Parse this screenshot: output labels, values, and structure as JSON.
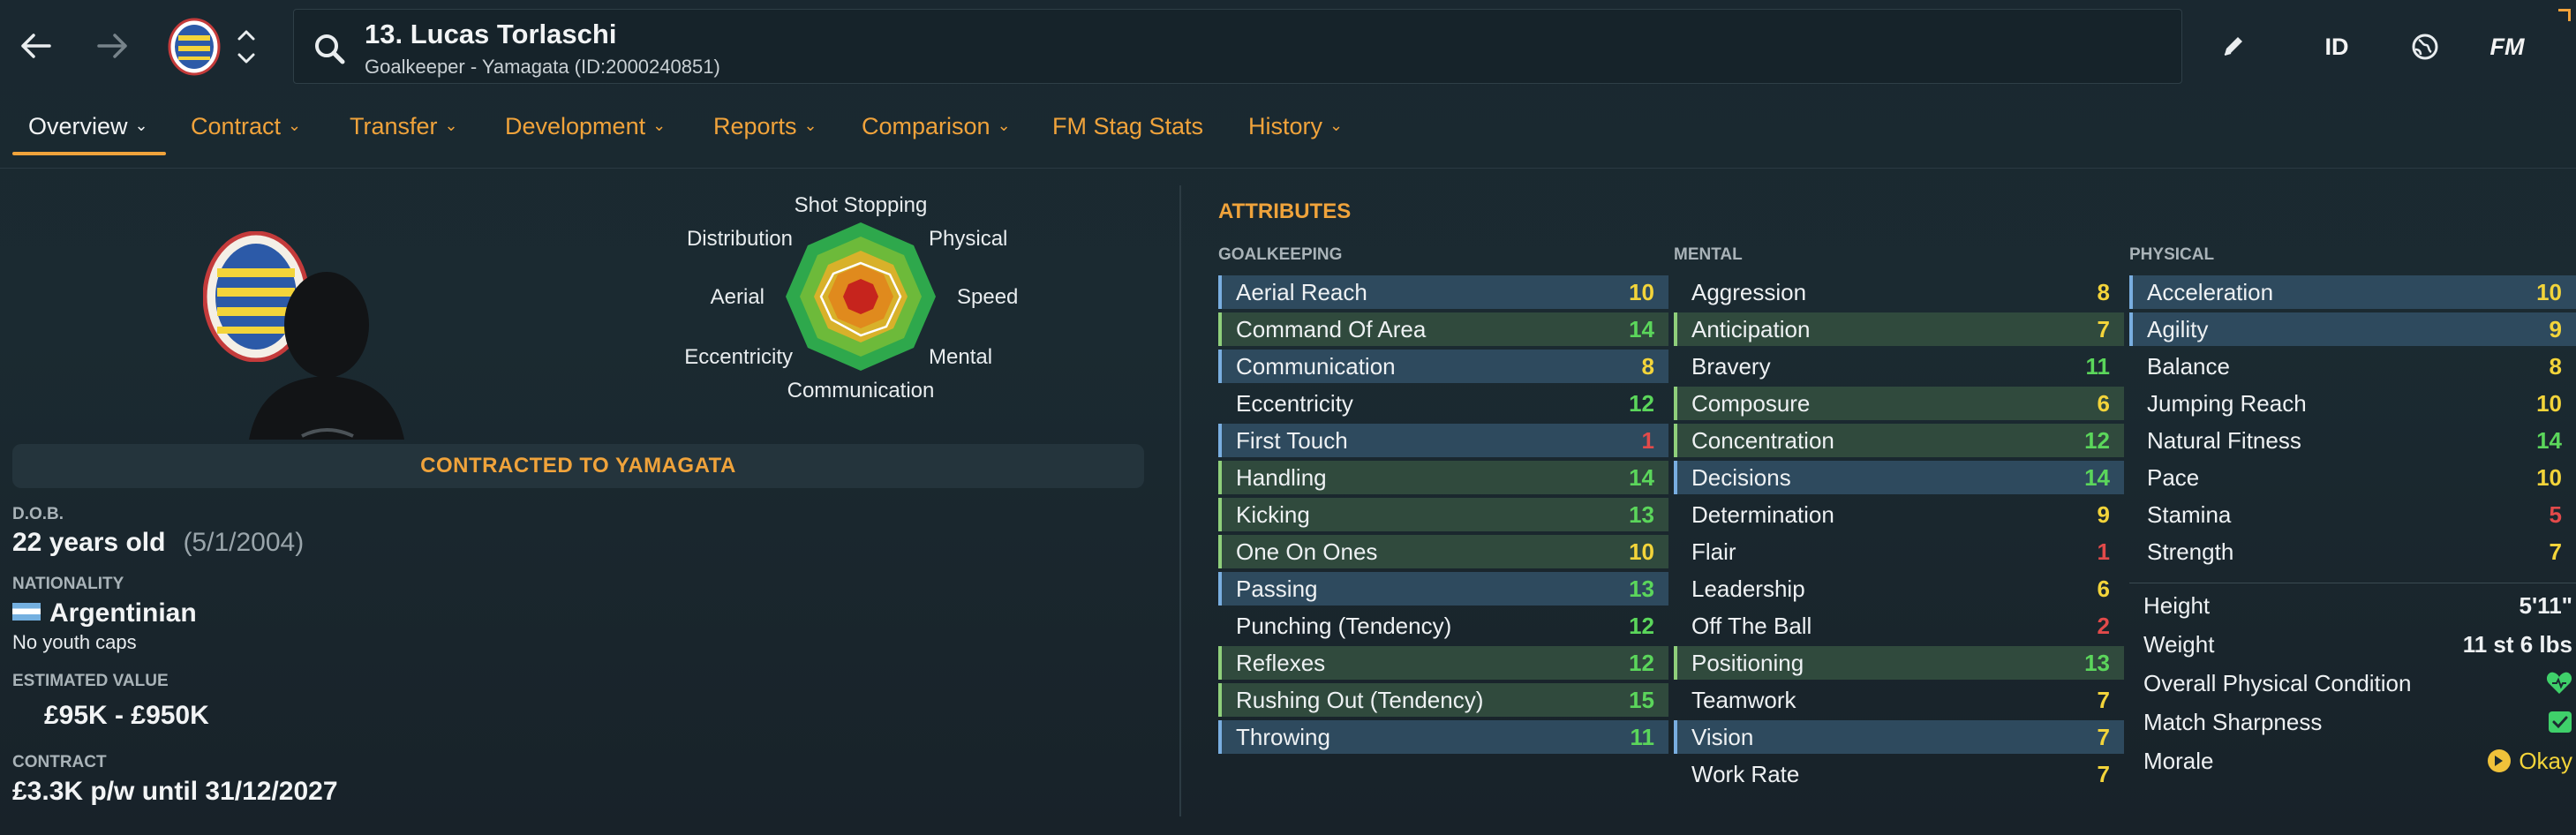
{
  "colors": {
    "accent": "#f0a33b",
    "attr_yellow": "#f3d43a",
    "attr_green": "#5bd65b",
    "attr_red": "#e24a4a",
    "attr_white": "#eef1f3",
    "row_blue": "#2e4a5e",
    "row_green": "#304a3d"
  },
  "header": {
    "title": "13. Lucas Torlaschi",
    "subtitle": "Goalkeeper - Yamagata (ID:2000240851)",
    "id_label": "ID",
    "fm_label": "FM"
  },
  "tabs": [
    {
      "label": "Overview"
    },
    {
      "label": "Contract"
    },
    {
      "label": "Transfer"
    },
    {
      "label": "Development"
    },
    {
      "label": "Reports"
    },
    {
      "label": "Comparison"
    },
    {
      "label": "FM Stag Stats"
    },
    {
      "label": "History"
    }
  ],
  "radar": {
    "labels": {
      "top": "Shot Stopping",
      "top_right": "Physical",
      "right": "Speed",
      "bottom_right": "Mental",
      "bottom": "Communication",
      "bottom_left": "Eccentricity",
      "left": "Aerial",
      "top_left": "Distribution"
    }
  },
  "contracted": "CONTRACTED TO YAMAGATA",
  "profile": {
    "dob_label": "D.O.B.",
    "age": "22 years old",
    "dob": "(5/1/2004)",
    "nationality_label": "NATIONALITY",
    "nationality": "Argentinian",
    "youth_caps": "No youth caps",
    "value_label": "ESTIMATED VALUE",
    "value": "£95K - £950K",
    "contract_label": "CONTRACT",
    "contract": "£3.3K p/w until 31/12/2027"
  },
  "attributes": {
    "title": "ATTRIBUTES",
    "goalkeeping": {
      "heading": "GOALKEEPING",
      "items": [
        {
          "name": "Aerial Reach",
          "value": "10",
          "hl": "blue"
        },
        {
          "name": "Command Of Area",
          "value": "14",
          "hl": "green"
        },
        {
          "name": "Communication",
          "value": "8",
          "hl": "blue"
        },
        {
          "name": "Eccentricity",
          "value": "12",
          "hl": ""
        },
        {
          "name": "First Touch",
          "value": "1",
          "hl": "blue"
        },
        {
          "name": "Handling",
          "value": "14",
          "hl": "green"
        },
        {
          "name": "Kicking",
          "value": "13",
          "hl": "green"
        },
        {
          "name": "One On Ones",
          "value": "10",
          "hl": "green"
        },
        {
          "name": "Passing",
          "value": "13",
          "hl": "blue"
        },
        {
          "name": "Punching (Tendency)",
          "value": "12",
          "hl": ""
        },
        {
          "name": "Reflexes",
          "value": "12",
          "hl": "green"
        },
        {
          "name": "Rushing Out (Tendency)",
          "value": "15",
          "hl": "green"
        },
        {
          "name": "Throwing",
          "value": "11",
          "hl": "blue"
        }
      ]
    },
    "mental": {
      "heading": "MENTAL",
      "items": [
        {
          "name": "Aggression",
          "value": "8",
          "hl": ""
        },
        {
          "name": "Anticipation",
          "value": "7",
          "hl": "green"
        },
        {
          "name": "Bravery",
          "value": "11",
          "hl": ""
        },
        {
          "name": "Composure",
          "value": "6",
          "hl": "green"
        },
        {
          "name": "Concentration",
          "value": "12",
          "hl": "green"
        },
        {
          "name": "Decisions",
          "value": "14",
          "hl": "blue"
        },
        {
          "name": "Determination",
          "value": "9",
          "hl": ""
        },
        {
          "name": "Flair",
          "value": "1",
          "hl": ""
        },
        {
          "name": "Leadership",
          "value": "6",
          "hl": ""
        },
        {
          "name": "Off The Ball",
          "value": "2",
          "hl": ""
        },
        {
          "name": "Positioning",
          "value": "13",
          "hl": "green"
        },
        {
          "name": "Teamwork",
          "value": "7",
          "hl": ""
        },
        {
          "name": "Vision",
          "value": "7",
          "hl": "blue"
        },
        {
          "name": "Work Rate",
          "value": "7",
          "hl": ""
        }
      ]
    },
    "physical": {
      "heading": "PHYSICAL",
      "items": [
        {
          "name": "Acceleration",
          "value": "10",
          "hl": "blue"
        },
        {
          "name": "Agility",
          "value": "9",
          "hl": "blue"
        },
        {
          "name": "Balance",
          "value": "8",
          "hl": ""
        },
        {
          "name": "Jumping Reach",
          "value": "10",
          "hl": ""
        },
        {
          "name": "Natural Fitness",
          "value": "14",
          "hl": ""
        },
        {
          "name": "Pace",
          "value": "10",
          "hl": ""
        },
        {
          "name": "Stamina",
          "value": "5",
          "hl": ""
        },
        {
          "name": "Strength",
          "value": "7",
          "hl": ""
        }
      ]
    },
    "info": [
      {
        "name": "Height",
        "value": "5'11\""
      },
      {
        "name": "Weight",
        "value": "11 st 6 lbs"
      },
      {
        "name": "Overall Physical Condition",
        "value": "",
        "icon": "heart-icon"
      },
      {
        "name": "Match Sharpness",
        "value": "",
        "icon": "check-icon"
      },
      {
        "name": "Morale",
        "value": "Okay",
        "icon": "morale-arrow-icon"
      }
    ]
  }
}
